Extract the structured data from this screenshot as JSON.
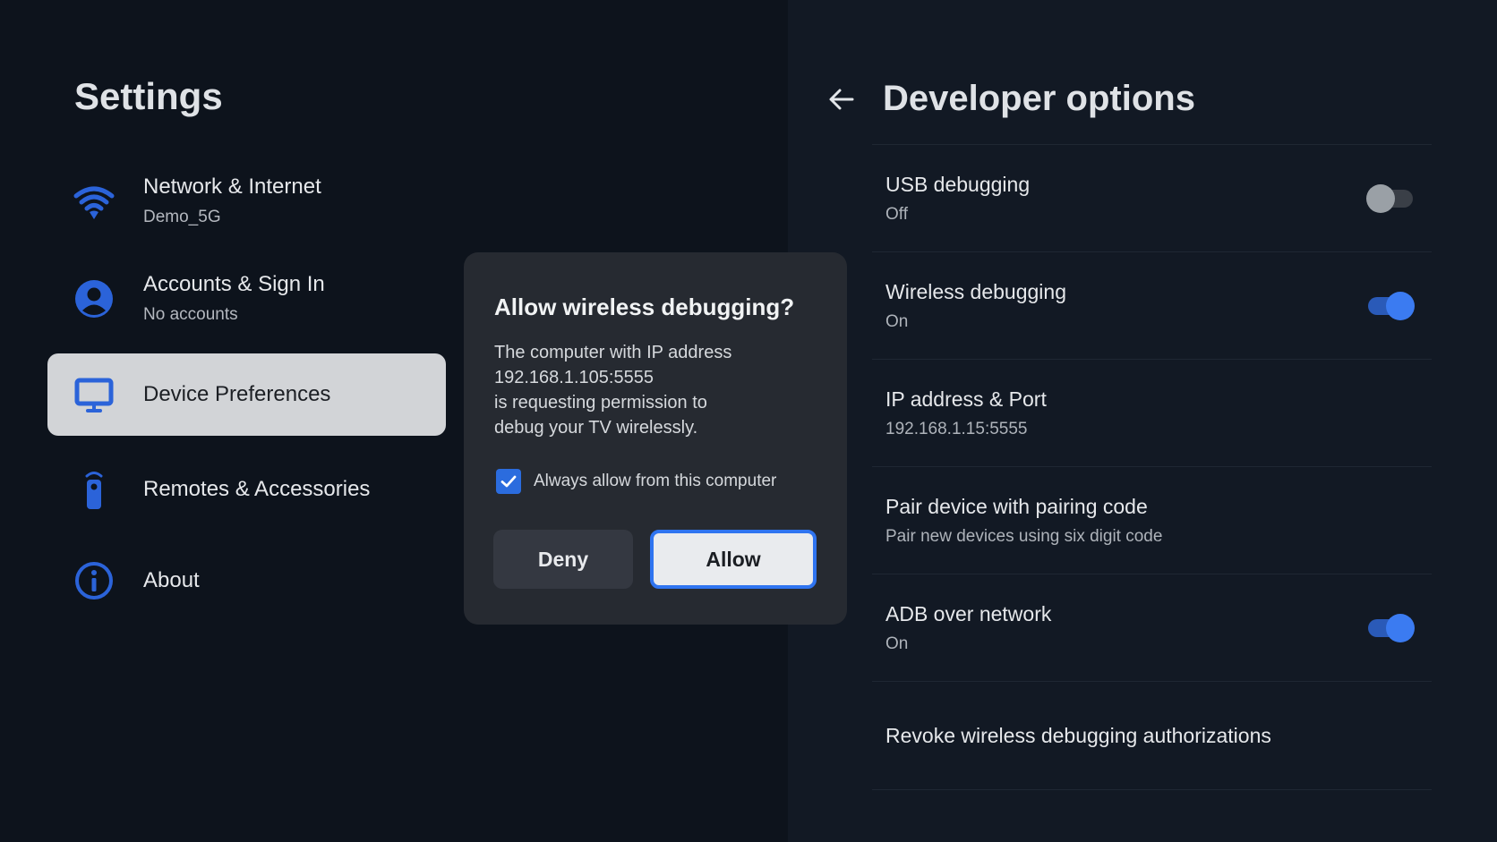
{
  "settings": {
    "title": "Settings",
    "items": [
      {
        "label": "Network & Internet",
        "sub": "Demo_5G",
        "icon": "wifi-icon"
      },
      {
        "label": "Accounts & Sign In",
        "sub": "No accounts",
        "icon": "account-icon"
      },
      {
        "label": "Device Preferences",
        "sub": "",
        "icon": "tv-icon",
        "selected": true
      },
      {
        "label": "Remotes & Accessories",
        "sub": "",
        "icon": "remote-icon"
      },
      {
        "label": "About",
        "sub": "",
        "icon": "info-icon"
      }
    ]
  },
  "dialog": {
    "title": "Allow wireless debugging?",
    "body_lines": [
      "The computer with IP address",
      "192.168.1.105:5555",
      "is requesting permission to",
      "debug your TV wirelessly."
    ],
    "checkbox_label": "Always allow from this computer",
    "checkbox_checked": true,
    "deny_label": "Deny",
    "allow_label": "Allow"
  },
  "developer": {
    "title": "Developer options",
    "back_icon": "back-arrow-icon",
    "items": [
      {
        "label": "USB debugging",
        "sub": "Off",
        "toggle": "off"
      },
      {
        "label": "Wireless debugging",
        "sub": "On",
        "toggle": "on"
      },
      {
        "label": "IP address & Port",
        "sub": "192.168.1.15:5555"
      },
      {
        "label": "Pair device with pairing code",
        "sub": "Pair new devices using six digit code"
      },
      {
        "label": "ADB over network",
        "sub": "On",
        "toggle": "on"
      },
      {
        "label": "Revoke wireless debugging authorizations",
        "sub": ""
      }
    ]
  },
  "colors": {
    "accent": "#2f74f0",
    "icon_blue": "#2b63d9",
    "background": "#0d131c"
  }
}
